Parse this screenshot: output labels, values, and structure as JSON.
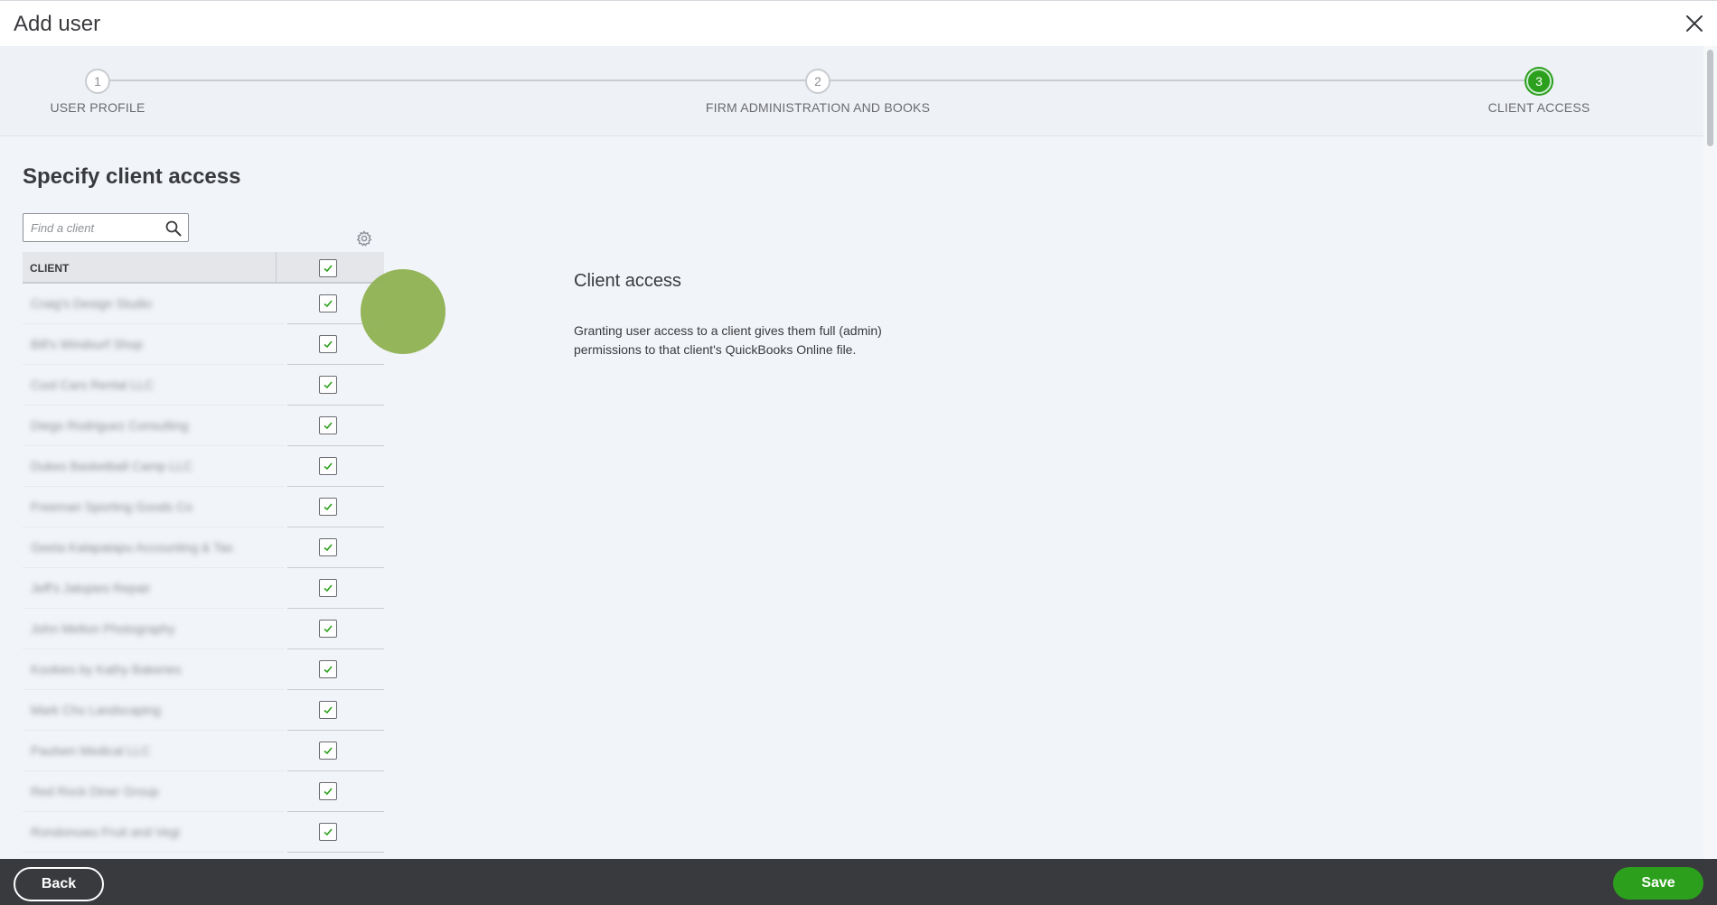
{
  "window": {
    "title": "Add user"
  },
  "stepper": {
    "steps": [
      {
        "number": "1",
        "label": "USER PROFILE",
        "state": "done"
      },
      {
        "number": "2",
        "label": "FIRM ADMINISTRATION AND BOOKS",
        "state": "done"
      },
      {
        "number": "3",
        "label": "CLIENT ACCESS",
        "state": "active"
      }
    ]
  },
  "main": {
    "title": "Specify client access",
    "search": {
      "placeholder": "Find a client",
      "value": ""
    },
    "table": {
      "column_header": "CLIENT",
      "select_all_checked": true,
      "rows": [
        {
          "name": "Craig's Design Studio",
          "checked": true
        },
        {
          "name": "Bill's Windsurf Shop",
          "checked": true
        },
        {
          "name": "Cool Cars Rental LLC",
          "checked": true
        },
        {
          "name": "Diego Rodriguez Consulting",
          "checked": true
        },
        {
          "name": "Dukes Basketball Camp LLC",
          "checked": true
        },
        {
          "name": "Freeman Sporting Goods Co",
          "checked": true
        },
        {
          "name": "Geeta Kalapatapu Accounting & Tax",
          "checked": true
        },
        {
          "name": "Jeff's Jalopies Repair",
          "checked": true
        },
        {
          "name": "John Melton Photography",
          "checked": true
        },
        {
          "name": "Kookies by Kathy Bakeries",
          "checked": true
        },
        {
          "name": "Mark Cho Landscaping",
          "checked": true
        },
        {
          "name": "Paulsen Medical LLC",
          "checked": true
        },
        {
          "name": "Red Rock Diner Group",
          "checked": true
        },
        {
          "name": "Rondonuwu Fruit and Vegi",
          "checked": true
        }
      ]
    }
  },
  "info": {
    "title": "Client access",
    "text": "Granting user access to a client gives them full (admin) permissions to that client's QuickBooks Online file."
  },
  "footer": {
    "back_label": "Back",
    "save_label": "Save"
  },
  "colors": {
    "accent": "#2ca01c",
    "footer_bg": "#393a3d",
    "page_bg": "#f1f4f8"
  }
}
